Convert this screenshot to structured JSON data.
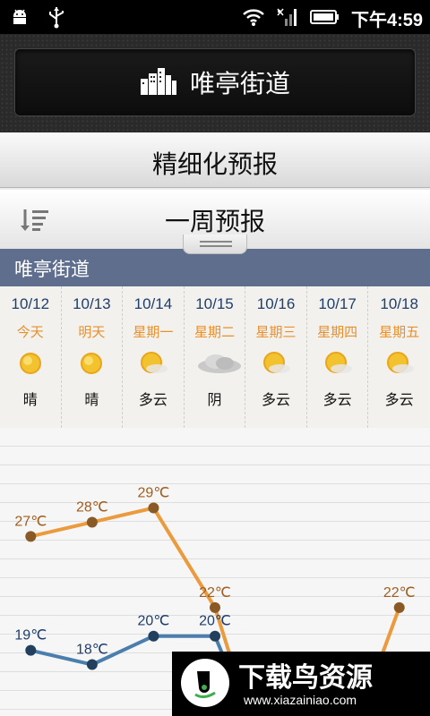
{
  "status_bar": {
    "time": "下午4:59",
    "left_icons": [
      "android-icon",
      "usb-icon"
    ],
    "right_icons": [
      "wifi-icon",
      "signal-icon",
      "battery-icon"
    ]
  },
  "header": {
    "city": "唯亭街道",
    "icon": "buildings-icon"
  },
  "tabs": {
    "fine_forecast": "精细化预报",
    "week_forecast": "一周预报",
    "sort_icon": "sort-icon"
  },
  "location": "唯亭街道",
  "forecast": [
    {
      "date": "10/12",
      "day": "今天",
      "condition": "晴",
      "icon": "sun-icon"
    },
    {
      "date": "10/13",
      "day": "明天",
      "condition": "晴",
      "icon": "sun-icon"
    },
    {
      "date": "10/14",
      "day": "星期一",
      "condition": "多云",
      "icon": "partly-cloudy-icon"
    },
    {
      "date": "10/15",
      "day": "星期二",
      "condition": "阴",
      "icon": "cloudy-icon"
    },
    {
      "date": "10/16",
      "day": "星期三",
      "condition": "多云",
      "icon": "partly-cloudy-icon"
    },
    {
      "date": "10/17",
      "day": "星期四",
      "condition": "多云",
      "icon": "partly-cloudy-icon"
    },
    {
      "date": "10/18",
      "day": "星期五",
      "condition": "多云",
      "icon": "partly-cloudy-icon"
    }
  ],
  "chart_data": {
    "type": "line",
    "x": [
      "10/12",
      "10/13",
      "10/14",
      "10/15",
      "10/16",
      "10/17",
      "10/18"
    ],
    "series": [
      {
        "values": [
          27,
          28,
          29,
          22,
          null,
          null,
          22
        ],
        "labels": [
          "27℃",
          "28℃",
          "29℃",
          "22℃",
          "",
          "",
          "22℃"
        ],
        "color": "#eb9a3e"
      },
      {
        "values": [
          19,
          18,
          20,
          20,
          null,
          null,
          null
        ],
        "labels": [
          "19℃",
          "18℃",
          "20℃",
          "20℃",
          "",
          "",
          ""
        ],
        "color": "#4a7fad"
      }
    ],
    "ylim": [
      12,
      34
    ],
    "grid": true
  },
  "watermark": {
    "title": "下载鸟资源",
    "url": "www.xiazainiao.com"
  }
}
